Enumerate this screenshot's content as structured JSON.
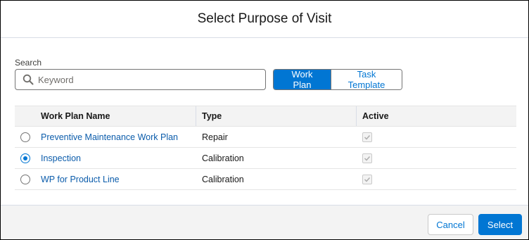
{
  "modal": {
    "title": "Select Purpose of Visit"
  },
  "search": {
    "label": "Search",
    "placeholder": "Keyword",
    "value": ""
  },
  "toggle": {
    "options": [
      {
        "label": "Work Plan",
        "selected": true
      },
      {
        "label": "Task Template",
        "selected": false
      }
    ]
  },
  "table": {
    "columns": [
      "Work Plan Name",
      "Type",
      "Active"
    ],
    "rows": [
      {
        "name": "Preventive Maintenance Work Plan",
        "type": "Repair",
        "active": true,
        "selected": false
      },
      {
        "name": "Inspection",
        "type": "Calibration",
        "active": true,
        "selected": true
      },
      {
        "name": "WP for Product Line",
        "type": "Calibration",
        "active": true,
        "selected": false
      }
    ]
  },
  "footer": {
    "cancel_label": "Cancel",
    "select_label": "Select"
  },
  "colors": {
    "brand": "#0176d3",
    "link": "#0b5cab",
    "footer_bg": "#f3f3f3",
    "header_bg": "#f3f3f3"
  },
  "icons": {
    "search": "search-icon",
    "checkbox": "check-icon"
  }
}
